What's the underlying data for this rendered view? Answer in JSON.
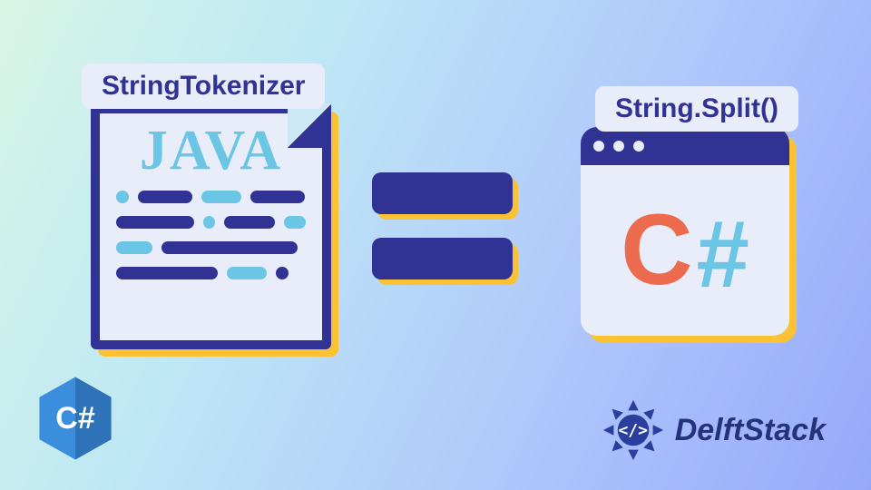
{
  "labels": {
    "left": "StringTokenizer",
    "right": "String.Split()"
  },
  "java_card": {
    "title": "JAVA"
  },
  "csharp_card": {
    "letter": "C",
    "hash": "#"
  },
  "hex_logo": {
    "text": "C#"
  },
  "brand": {
    "name": "DelftStack",
    "code_glyph": "</>"
  },
  "colors": {
    "deep_blue": "#303294",
    "sky_blue": "#6bc6e6",
    "yellow": "#fbc234",
    "coral": "#ec6a4e",
    "panel": "#e9ecf9"
  }
}
